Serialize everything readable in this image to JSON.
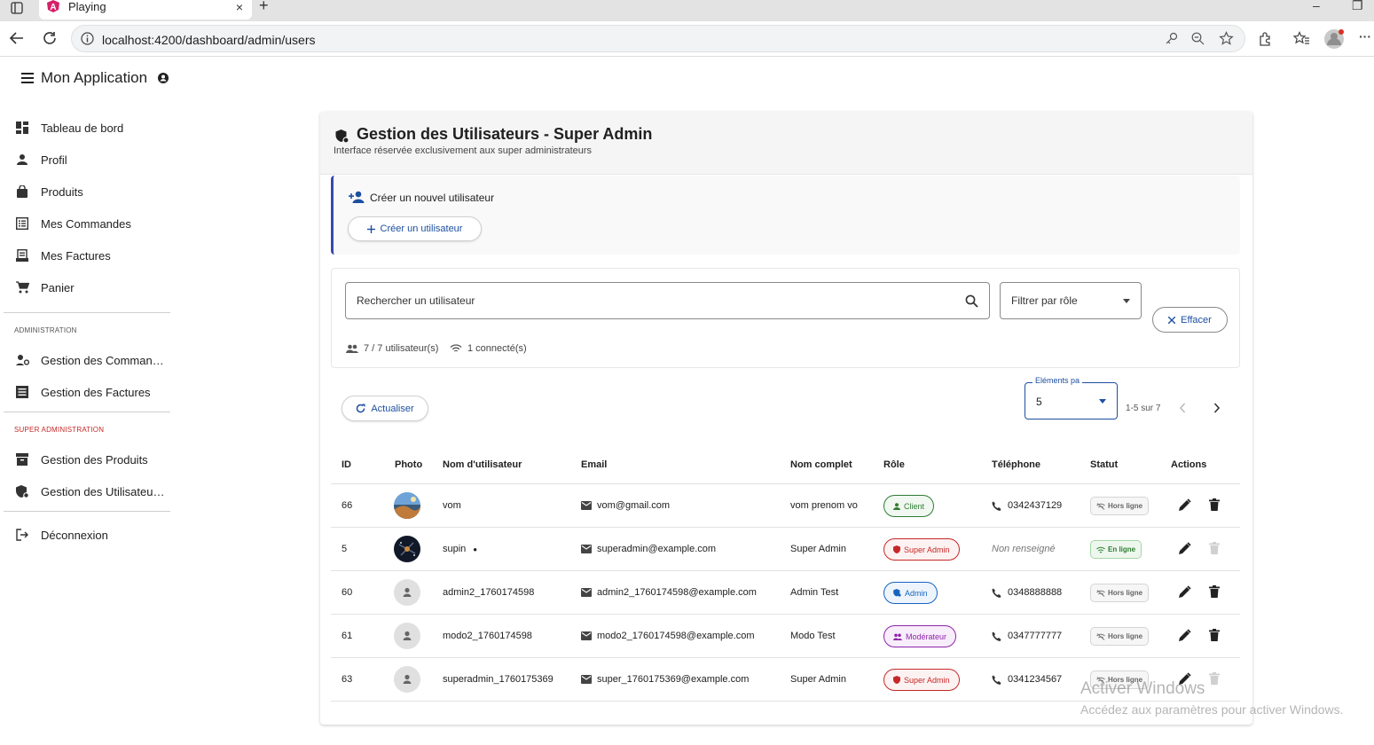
{
  "browser": {
    "tab_title": "Playing",
    "tab_close": "×",
    "new_tab": "+",
    "url": "localhost:4200/dashboard/admin/users",
    "win_min": "–",
    "win_restore": "❐"
  },
  "app": {
    "title": "Mon Application"
  },
  "sidebar": {
    "items": [
      {
        "label": "Tableau de bord",
        "icon": "dashboard-icon"
      },
      {
        "label": "Profil",
        "icon": "person-icon"
      },
      {
        "label": "Produits",
        "icon": "shopping-bag-icon"
      },
      {
        "label": "Mes Commandes",
        "icon": "list-alt-icon"
      },
      {
        "label": "Mes Factures",
        "icon": "receipt-icon"
      },
      {
        "label": "Panier",
        "icon": "cart-icon"
      }
    ],
    "admin_section": "ADMINISTRATION",
    "admin_items": [
      {
        "label": "Gestion des Comman…",
        "icon": "manage-accounts-icon"
      },
      {
        "label": "Gestion des Factures",
        "icon": "list-icon"
      }
    ],
    "superadmin_section": "SUPER ADMINISTRATION",
    "superadmin_items": [
      {
        "label": "Gestion des Produits",
        "icon": "inventory-icon"
      },
      {
        "label": "Gestion des Utilisateu…",
        "icon": "admin-panel-icon"
      }
    ],
    "logout": "Déconnexion"
  },
  "page": {
    "title": "Gestion des Utilisateurs - Super Admin",
    "subtitle": "Interface réservée exclusivement aux super administrateurs"
  },
  "create": {
    "heading": "Créer un nouvel utilisateur",
    "button": "Créer un utilisateur"
  },
  "filters": {
    "search_placeholder": "Rechercher un utilisateur",
    "role_placeholder": "Filtrer par rôle",
    "clear": "Effacer",
    "count_users": "7 / 7 utilisateur(s)",
    "count_online": "1 connecté(s)"
  },
  "toolbar": {
    "refresh": "Actualiser",
    "page_size_label": "Eléments pa",
    "page_size": "5",
    "range": "1-5 sur 7"
  },
  "table": {
    "headers": [
      "ID",
      "Photo",
      "Nom d'utilisateur",
      "Email",
      "Nom complet",
      "Rôle",
      "Téléphone",
      "Statut",
      "Actions"
    ],
    "rows": [
      {
        "id": "66",
        "photo": "landscape",
        "username": "vom",
        "online_dot": "",
        "email": "vom@gmail.com",
        "full_name": "vom prenom vo",
        "role": "Client",
        "phone": "0342437129",
        "status": "Hors ligne"
      },
      {
        "id": "5",
        "photo": "night",
        "username": "supin",
        "online_dot": "●",
        "email": "superadmin@example.com",
        "full_name": "Super Admin",
        "role": "Super Admin",
        "phone": "Non renseigné",
        "status": "En ligne"
      },
      {
        "id": "60",
        "photo": "placeholder",
        "username": "admin2_1760174598",
        "online_dot": "",
        "email": "admin2_1760174598@example.com",
        "full_name": "Admin Test",
        "role": "Admin",
        "phone": "0348888888",
        "status": "Hors ligne"
      },
      {
        "id": "61",
        "photo": "placeholder",
        "username": "modo2_1760174598",
        "online_dot": "",
        "email": "modo2_1760174598@example.com",
        "full_name": "Modo Test",
        "role": "Modérateur",
        "phone": "0347777777",
        "status": "Hors ligne"
      },
      {
        "id": "63",
        "photo": "placeholder",
        "username": "superadmin_1760175369",
        "online_dot": "",
        "email": "super_1760175369@example.com",
        "full_name": "Super Admin",
        "role": "Super Admin",
        "phone": "0341234567",
        "status": "Hors ligne"
      }
    ]
  },
  "watermark": {
    "line1": "Activer Windows",
    "line2": "Accédez aux paramètres pour activer Windows."
  },
  "colors": {
    "primary": "#1c4fa0",
    "accent_bar": "#3949ab",
    "client": "#2e7d32",
    "super_admin": "#c62828",
    "admin": "#1565c0",
    "moderateur": "#8e24aa",
    "super_admin_section": "#c62828"
  }
}
